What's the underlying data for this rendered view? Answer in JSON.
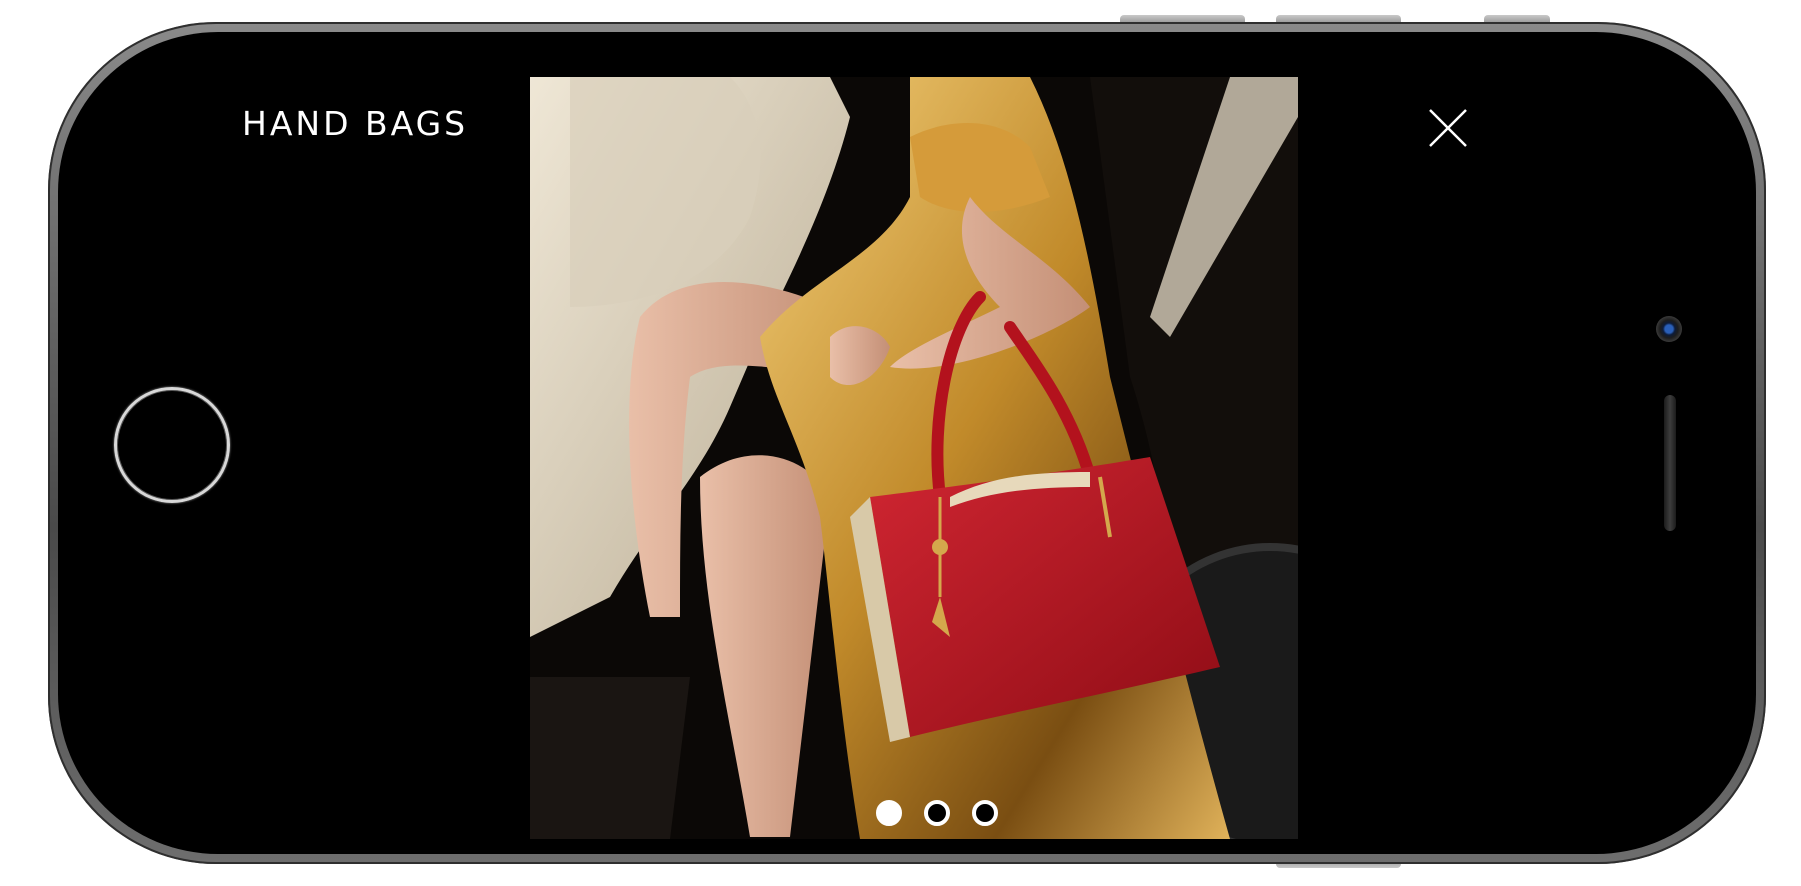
{
  "header": {
    "title": "HAND BAGS",
    "close_icon": "close-icon"
  },
  "gallery": {
    "total_slides": 3,
    "active_index": 0,
    "image_subject": "red-handbag-photo"
  },
  "device": {
    "home_button_icon": "home-button-ring",
    "camera_icon": "front-camera-icon",
    "speaker_icon": "earpiece-speaker-icon"
  },
  "colors": {
    "screen_bg": "#000000",
    "text": "#ffffff",
    "bag_red": "#b3121d",
    "dress_gold": "#c8922e"
  }
}
